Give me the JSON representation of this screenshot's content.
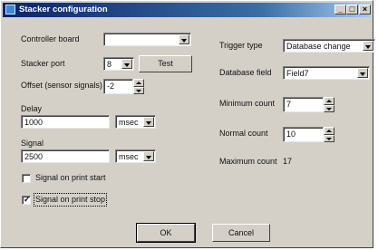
{
  "window": {
    "title": "Stacker configuration",
    "minimize_glyph": "_",
    "restore_glyph": "□",
    "close_glyph": "×"
  },
  "left": {
    "controller_board": {
      "label": "Controller board",
      "value": ""
    },
    "stacker_port": {
      "label": "Stacker port",
      "value": "8",
      "test_label": "Test"
    },
    "offset": {
      "label": "Offset (sensor signals)",
      "value": "-2"
    },
    "delay": {
      "label": "Delay",
      "value": "1000",
      "unit": "msec"
    },
    "signal": {
      "label": "Signal",
      "value": "2500",
      "unit": "msec"
    },
    "signal_on_print_start": {
      "label": "Signal on print start",
      "checked": false
    },
    "signal_on_print_stop": {
      "label": "Signal on print stop",
      "checked": true,
      "mark": "✓"
    }
  },
  "right": {
    "trigger_type": {
      "label": "Trigger type",
      "value": "Database change"
    },
    "database_field": {
      "label": "Database field",
      "value": "Field7"
    },
    "minimum_count": {
      "label": "Minimum count",
      "value": "7"
    },
    "normal_count": {
      "label": "Normal count",
      "value": "10"
    },
    "maximum_count": {
      "label": "Maximum count",
      "value": "17"
    }
  },
  "buttons": {
    "ok": "OK",
    "cancel": "Cancel"
  }
}
